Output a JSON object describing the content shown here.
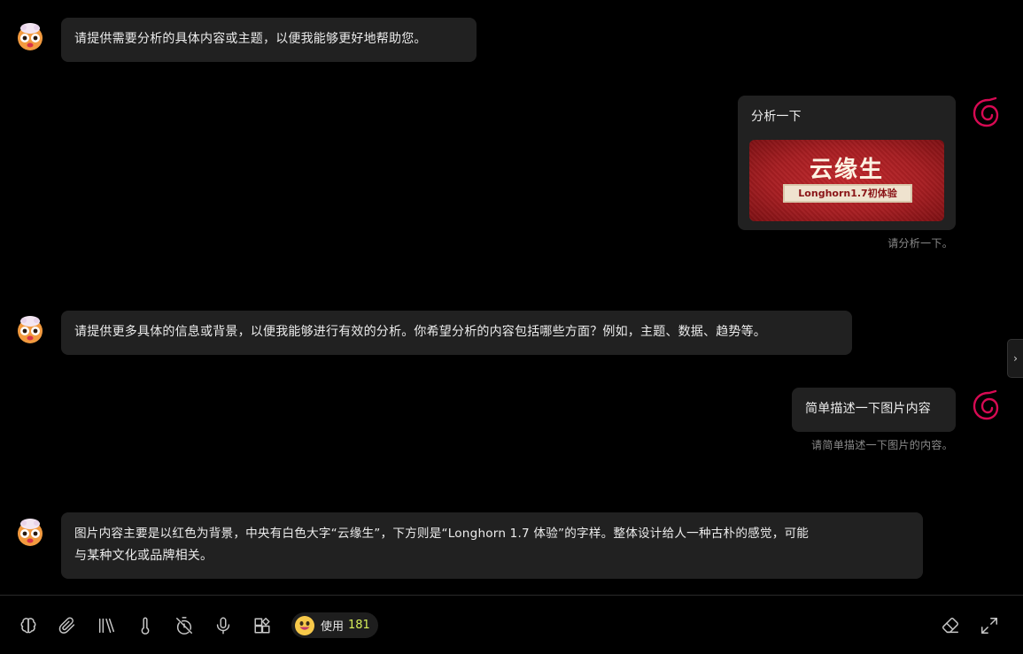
{
  "messages": [
    {
      "role": "assistant",
      "text": "请提供需要分析的具体内容或主题，以便我能够更好地帮助您。"
    },
    {
      "role": "user",
      "text": "分析一下",
      "caption": "请分析一下。",
      "image": {
        "title": "云缘生",
        "subtitle": "Longhorn1.7初体验"
      }
    },
    {
      "role": "assistant",
      "text": "请提供更多具体的信息或背景，以便我能够进行有效的分析。你希望分析的内容包括哪些方面？例如，主题、数据、趋势等。"
    },
    {
      "role": "user",
      "text": "简单描述一下图片内容",
      "caption": "请简单描述一下图片的内容。"
    },
    {
      "role": "assistant",
      "text_lines": [
        "图片内容主要是以红色为背景，中央有白色大字“云缘生”，下方则是“Longhorn 1.7 体验”的字样。整体设计给人一种古朴的感觉，可能",
        "与某种文化或品牌相关。"
      ]
    }
  ],
  "toolbar": {
    "usage_label": "使用",
    "usage_count": "181",
    "icons": [
      "brain-icon",
      "paperclip-icon",
      "library-icon",
      "thermometer-icon",
      "timer-off-icon",
      "microphone-icon",
      "plugin-icon",
      "eraser-icon",
      "expand-icon"
    ]
  },
  "side_tab": {
    "glyph": "›"
  },
  "colors": {
    "bubble": "#212121",
    "usage_count": "#d7ef5a",
    "image_red": "#a81e22",
    "user_avatar": "#d70a53"
  }
}
